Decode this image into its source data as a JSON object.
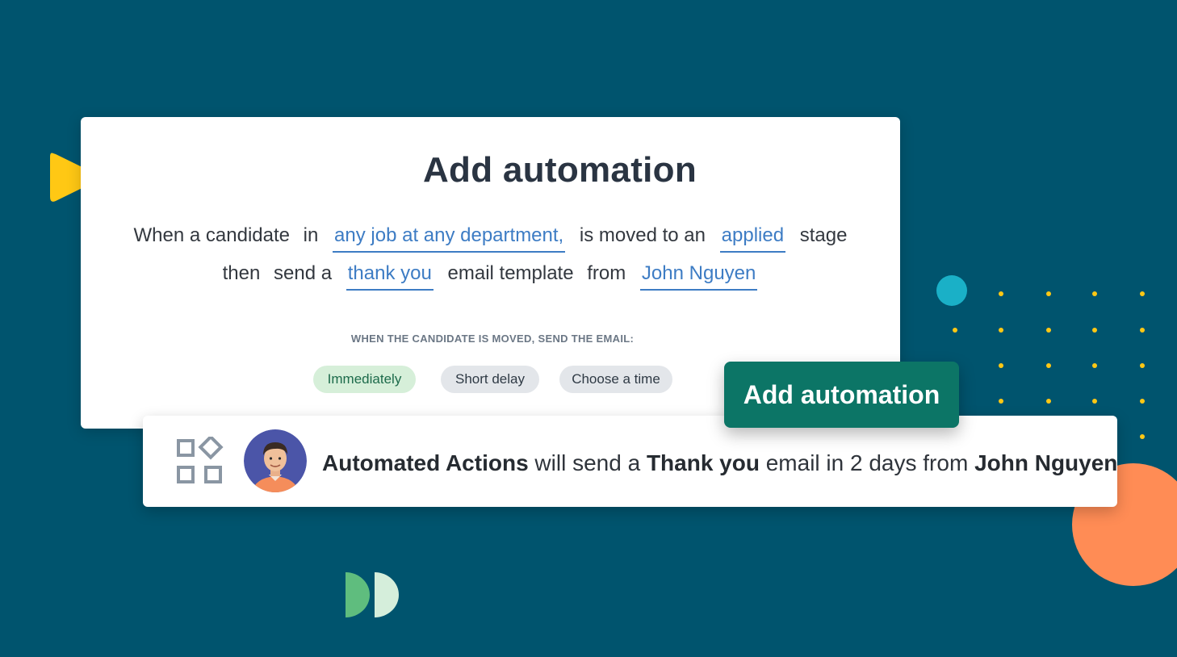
{
  "card": {
    "title": "Add automation",
    "line1": {
      "w1": "When a candidate",
      "w2": "in",
      "job_scope": "any job at any department,",
      "w3": "is moved to an",
      "stage": "applied",
      "w4": "stage"
    },
    "line2": {
      "w1": "then",
      "w2": "send a",
      "template": "thank you",
      "w3": "email template",
      "w4": "from",
      "sender": "John Nguyen"
    },
    "timing_label": "WHEN THE CANDIDATE IS MOVED, SEND THE EMAIL:",
    "timing_options": [
      "Immediately",
      "Short delay",
      "Choose a time"
    ],
    "selected_timing": "Immediately"
  },
  "add_button_label": "Add automation",
  "notification": {
    "actor": "Automated Actions",
    "t1": " will send a ",
    "template": "Thank you",
    "t2": " email in 2 days from ",
    "sender": "John Nguyen"
  },
  "colors": {
    "background": "#00546e",
    "link": "#3d7cc4",
    "button": "#0c7566",
    "selected_pill": "#d6efd9",
    "accent_yellow": "#ffc814",
    "accent_orange": "#ff8c55",
    "accent_teal": "#1ab0c7"
  },
  "icons": [
    "apps-grid-icon",
    "play-icon",
    "avatar"
  ]
}
